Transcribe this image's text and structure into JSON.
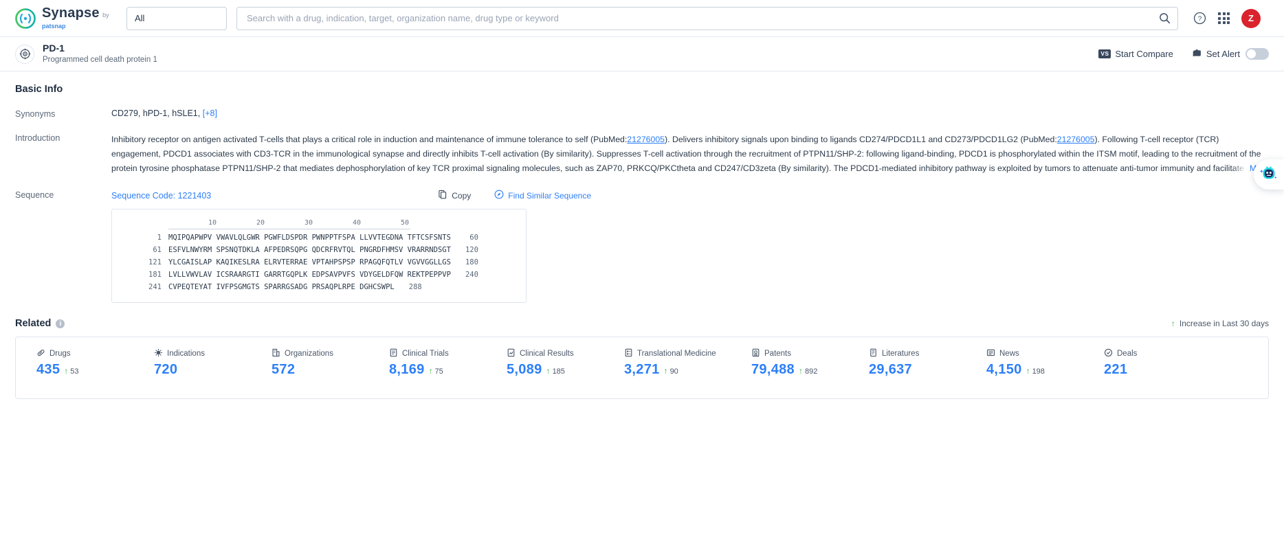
{
  "topbar": {
    "logo": {
      "title": "Synapse",
      "by": "by",
      "brand": "patsnap",
      "icon": "synapse-logo-icon"
    },
    "scope": {
      "value": "All",
      "icon": "chevron-down-icon"
    },
    "search": {
      "value": "",
      "placeholder": "Search with a drug, indication, target, organization name, drug type or keyword",
      "icon": "search-icon"
    },
    "help_icon": "help-circle-icon",
    "apps_icon": "app-grid-icon",
    "avatar_initial": "Z"
  },
  "entity": {
    "icon": "target-icon",
    "name": "PD-1",
    "description": "Programmed cell death protein 1",
    "compare_label": "Start Compare",
    "compare_badge": "VS",
    "alert_label": "Set Alert",
    "alert_icon": "bell-alert-icon",
    "alert_enabled": false
  },
  "basic_info": {
    "heading": "Basic Info",
    "synonyms_label": "Synonyms",
    "synonyms": "CD279,  hPD-1,  hSLE1,",
    "synonyms_more": "[+8]",
    "introduction_label": "Introduction",
    "introduction": {
      "p1": "Inhibitory receptor on antigen activated T-cells that plays a critical role in induction and maintenance of immune tolerance to self (PubMed:",
      "pubmed1": "21276005",
      "p2": "). Delivers inhibitory signals upon binding to ligands CD274/PDCD1L1 and CD273/PDCD1LG2 (PubMed:",
      "pubmed2": "21276005",
      "p3": "). Following T-cell receptor (TCR) engagement, PDCD1 associates with CD3-TCR in the immunological synapse and directly inhibits T-cell activation (By similarity). Suppresses T-cell activation through the recruitment of PTPN11/SHP-2: following ligand-binding, PDCD1 is phosphorylated within the ITSM motif, leading to the recruitment of the protein tyrosine phosphatase PTPN11/SHP-2 that mediates dephosphorylation of key TCR proximal signaling molecules, such as ZAP70, PRKCQ/PKCtheta and CD247/CD3zeta (By similarity). The PDCD1-mediated inhibitory pathway is exploited by tumors to attenuate anti-tumor immunity and facilitate tumor survival.",
      "more_label": "More"
    }
  },
  "sequence": {
    "label": "Sequence",
    "code_label": "Sequence Code: 1221403",
    "copy_label": "Copy",
    "copy_icon": "copy-icon",
    "similar_label": "Find Similar Sequence",
    "similar_icon": "compass-icon",
    "ruler": [
      "10",
      "20",
      "30",
      "40",
      "50"
    ],
    "rows": [
      {
        "start": "1",
        "chunks": "MQIPQAPWPV VWAVLQLGWR PGWFLDSPDR PWNPPTFSPA LLVVTEGDNA TFTCSFSNTS",
        "end": "60"
      },
      {
        "start": "61",
        "chunks": "ESFVLNWYRM SPSNQTDKLA AFPEDRSQPG QDCRFRVTQL PNGRDFHMSV VRARRNDSGT",
        "end": "120"
      },
      {
        "start": "121",
        "chunks": "YLCGAISLAP KAQIKESLRA ELRVTERRAE VPTAHPSPSP RPAGQFQTLV VGVVGGLLGS",
        "end": "180"
      },
      {
        "start": "181",
        "chunks": "LVLLVWVLAV ICSRAARGTI GARRTGQPLK EDPSAVPVFS VDYGELDFQW REKTPEPPVP",
        "end": "240"
      },
      {
        "start": "241",
        "chunks": "CVPEQTEYAT IVFPSGMGTS SPARRGSADG PRSAQPLRPE DGHCSWPL",
        "end": "288"
      }
    ]
  },
  "related": {
    "heading": "Related",
    "info_icon": "info-icon",
    "increase_note": "Increase in Last 30 days",
    "increase_arrow": "arrow-up-icon",
    "stats": [
      {
        "label": "Drugs",
        "icon": "pill-icon",
        "value": "435",
        "delta": "53"
      },
      {
        "label": "Indications",
        "icon": "virus-icon",
        "value": "720",
        "delta": ""
      },
      {
        "label": "Organizations",
        "icon": "building-icon",
        "value": "572",
        "delta": ""
      },
      {
        "label": "Clinical Trials",
        "icon": "trial-icon",
        "value": "8,169",
        "delta": "75"
      },
      {
        "label": "Clinical Results",
        "icon": "results-icon",
        "value": "5,089",
        "delta": "185"
      },
      {
        "label": "Translational Medicine",
        "icon": "medicine-icon",
        "value": "3,271",
        "delta": "90"
      },
      {
        "label": "Patents",
        "icon": "patent-icon",
        "value": "79,488",
        "delta": "892"
      },
      {
        "label": "Literatures",
        "icon": "literature-icon",
        "value": "29,637",
        "delta": ""
      },
      {
        "label": "News",
        "icon": "news-icon",
        "value": "4,150",
        "delta": "198"
      },
      {
        "label": "Deals",
        "icon": "deals-icon",
        "value": "221",
        "delta": ""
      }
    ]
  },
  "assistant": {
    "icon": "ai-assistant-icon"
  },
  "colors": {
    "accent": "#2d7ff9",
    "increase": "#3fae4a",
    "avatar": "#d9232d",
    "brand_teal": "#2ec4a6"
  }
}
